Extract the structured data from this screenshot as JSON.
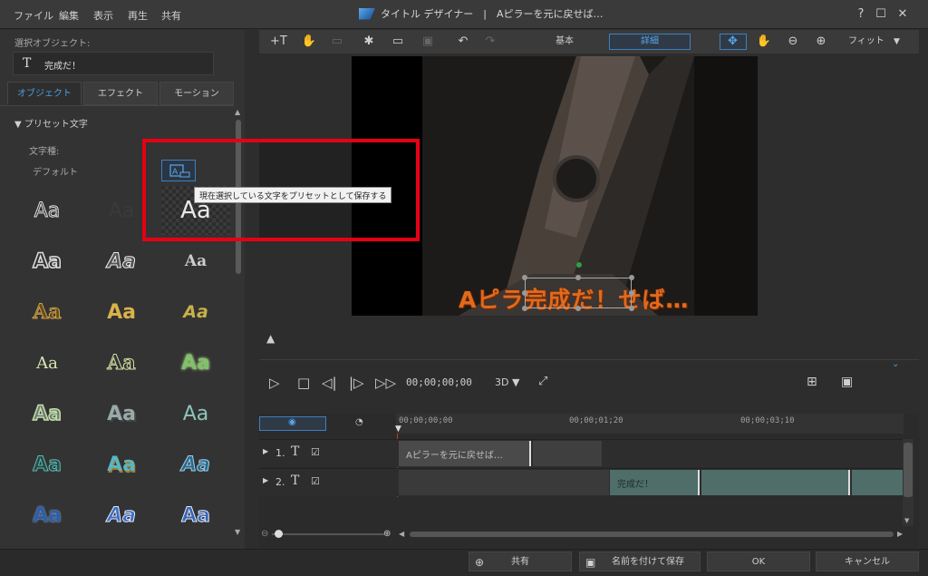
{
  "menu": [
    "ファイル",
    "編集",
    "表示",
    "再生",
    "共有"
  ],
  "window": {
    "title": "タイトル デザイナー　|　Aピラーを元に戻せば…",
    "help_glyph": "?",
    "maximize_glyph": "☐",
    "close_glyph": "✕"
  },
  "left_panel": {
    "selected_object_label": "選択オブジェクト:",
    "selected_object_value": "完成だ！",
    "text_icon_glyph": "T",
    "tabs": [
      "オブジェクト",
      "エフェクト",
      "モーション"
    ],
    "active_tab": 0,
    "section_title": "▼ プリセット文字",
    "font_type_label": "文字種:",
    "font_type_value": "デフォルト",
    "preset_sample": "Aa",
    "tooltip": "現在選択している文字をプリセットとして保存する"
  },
  "toolbar": {
    "basic_label": "基本",
    "detail_label": "詳細",
    "fit_label": "フィット",
    "dropdown_glyph": "▼"
  },
  "preview": {
    "overlay_text": "Aピラ完成だ！せば…"
  },
  "playback": {
    "timecode": "00;00;00;00",
    "mode": "3D ▼"
  },
  "timeline": {
    "ticks": [
      "00;00;00;00",
      "00;00;01;20",
      "00;00;03;10"
    ],
    "tracks": [
      {
        "num": "1.",
        "icon": "T",
        "clip": "Aピラーを元に戻せば…"
      },
      {
        "num": "2.",
        "icon": "T",
        "clip": "完成だ！"
      }
    ]
  },
  "bottom": {
    "share": "共有",
    "save_as": "名前を付けて保存",
    "ok": "OK",
    "cancel": "キャンセル"
  },
  "colors": {
    "accent": "#4d9de0",
    "highlight_box": "#e60012",
    "title_orange": "#e06a1e",
    "clip_teal": "#4f6e6a"
  }
}
